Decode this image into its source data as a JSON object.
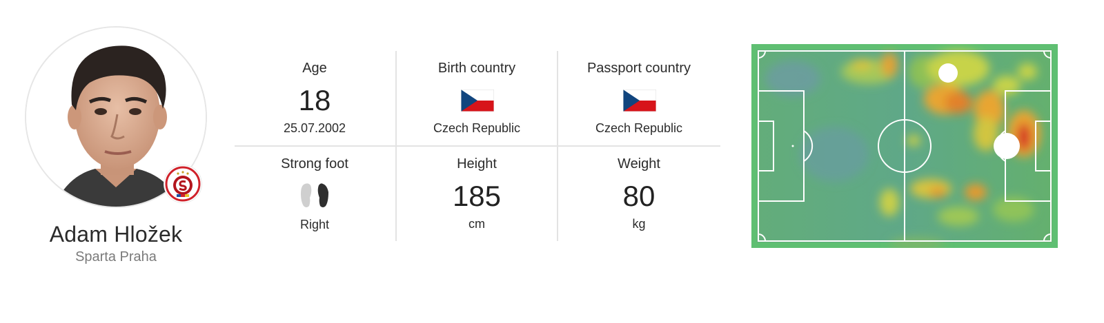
{
  "player": {
    "name": "Adam Hložek",
    "club": "Sparta Praha",
    "avatar_icon": "player-portrait",
    "club_logo": "sparta-praha-badge"
  },
  "stats": {
    "age": {
      "label": "Age",
      "value": "18",
      "sub": "25.07.2002"
    },
    "birth_country": {
      "label": "Birth country",
      "flag": "czech-flag",
      "value": "Czech Republic"
    },
    "passport_country": {
      "label": "Passport country",
      "flag": "czech-flag",
      "value": "Czech Republic"
    },
    "strong_foot": {
      "label": "Strong foot",
      "icon": "feet-icon",
      "value": "Right"
    },
    "height": {
      "label": "Height",
      "value": "185",
      "unit": "cm"
    },
    "weight": {
      "label": "Weight",
      "value": "80",
      "unit": "kg"
    }
  },
  "heatmap": {
    "icon": "football-pitch-heatmap",
    "colors": {
      "pitch": "#5fb36a",
      "hot": "#d9302a",
      "warm": "#e89a2a",
      "mild": "#c9d54a",
      "cool": "#6fa8a0"
    }
  }
}
